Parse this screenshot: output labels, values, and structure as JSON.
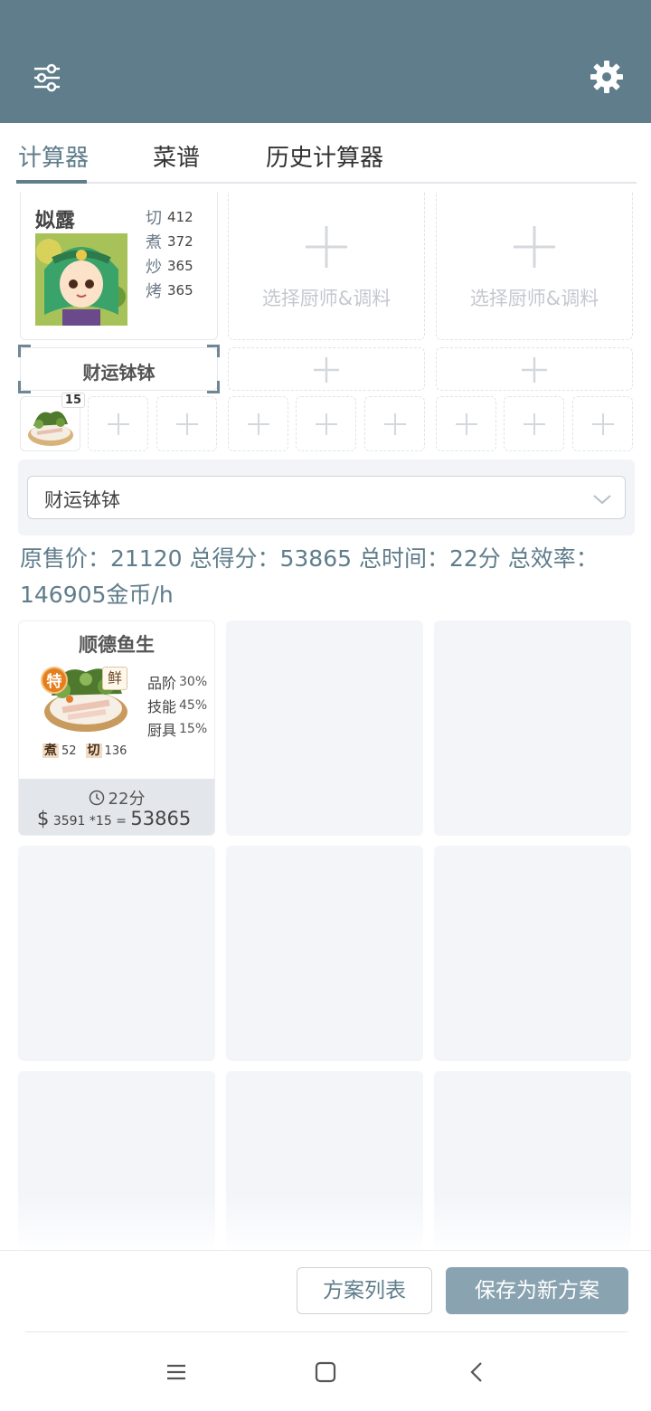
{
  "header": {
    "menu_icon": "sliders-icon",
    "settings_icon": "gear-icon"
  },
  "tabs": [
    {
      "label": "计算器",
      "active": true
    },
    {
      "label": "菜谱",
      "active": false
    },
    {
      "label": "历史计算器",
      "active": false
    }
  ],
  "chefs": [
    {
      "name": "姒露",
      "stats": [
        {
          "k": "切",
          "v": "412"
        },
        {
          "k": "煮",
          "v": "372"
        },
        {
          "k": "炒",
          "v": "365"
        },
        {
          "k": "烤",
          "v": "365"
        }
      ],
      "equip": "财运钵钵",
      "slot_count": "15"
    },
    {
      "empty_label": "选择厨师&调料"
    },
    {
      "empty_label": "选择厨师&调料"
    }
  ],
  "select": {
    "value": "财运钵钵"
  },
  "summary": "原售价：21120 总得分：53865 总时间：22分 总效率：146905金币/h",
  "dishes": [
    {
      "name": "顺德鱼生",
      "badge_special": "特",
      "badge_fresh": "鲜",
      "skills": [
        {
          "k": "煮",
          "v": "52"
        },
        {
          "k": "切",
          "v": "136"
        }
      ],
      "bonus": [
        {
          "k": "品阶",
          "v": "30%"
        },
        {
          "k": "技能",
          "v": "45%"
        },
        {
          "k": "厨具",
          "v": "15%"
        }
      ],
      "time": "22分",
      "price": "3591",
      "mult": "*15",
      "eq": "=",
      "total": "53865"
    }
  ],
  "buttons": {
    "list": "方案列表",
    "save": "保存为新方案"
  },
  "colors": {
    "primary": "#5f7d8b",
    "save_button": "#8aa3b0",
    "special_badge": "#e57e1e"
  }
}
